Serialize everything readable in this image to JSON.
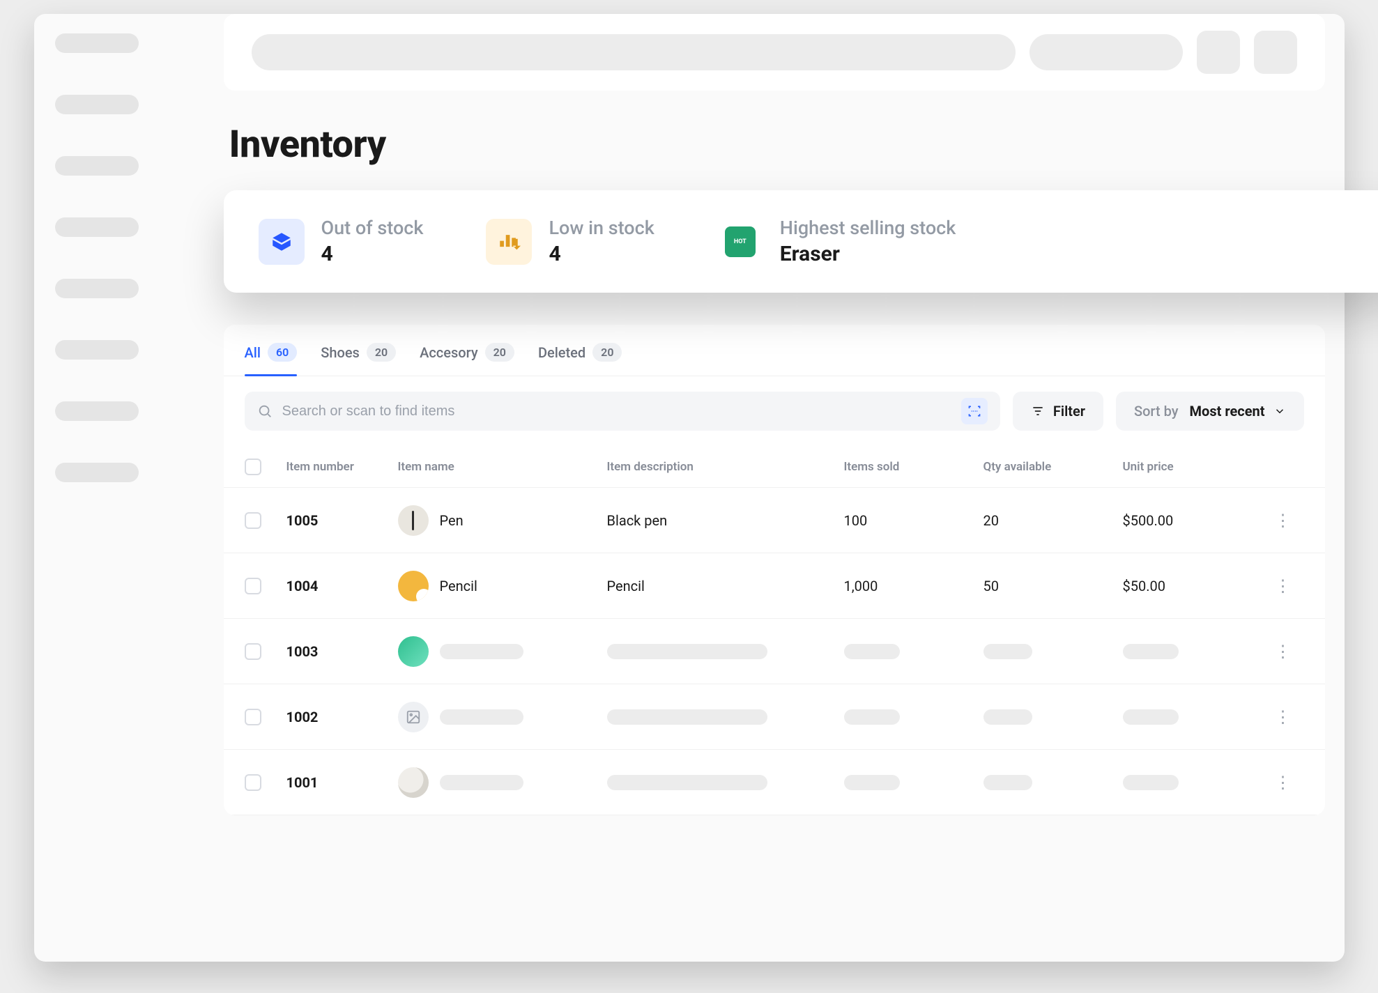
{
  "page": {
    "title": "Inventory"
  },
  "stats": {
    "out_of_stock": {
      "label": "Out of stock",
      "value": "4"
    },
    "low_in_stock": {
      "label": "Low in stock",
      "value": "4"
    },
    "highest_selling": {
      "label": "Highest selling stock",
      "value": "Eraser"
    }
  },
  "tabs": [
    {
      "label": "All",
      "count": "60",
      "active": true
    },
    {
      "label": "Shoes",
      "count": "20",
      "active": false
    },
    {
      "label": "Accesory",
      "count": "20",
      "active": false
    },
    {
      "label": "Deleted",
      "count": "20",
      "active": false
    }
  ],
  "search": {
    "placeholder": "Search or scan to find items"
  },
  "filter": {
    "label": "Filter"
  },
  "sort": {
    "label": "Sort by",
    "value": "Most recent"
  },
  "columns": {
    "item_number": "Item number",
    "item_name": "Item name",
    "item_description": "Item description",
    "items_sold": "Items sold",
    "qty_available": "Qty available",
    "unit_price": "Unit price"
  },
  "rows": [
    {
      "number": "1005",
      "name": "Pen",
      "desc": "Black pen",
      "sold": "100",
      "qty": "20",
      "price": "$500.00",
      "thumb": "pen"
    },
    {
      "number": "1004",
      "name": "Pencil",
      "desc": "Pencil",
      "sold": "1,000",
      "qty": "50",
      "price": "$50.00",
      "thumb": "pencil"
    },
    {
      "number": "1003",
      "name": "",
      "desc": "",
      "sold": "",
      "qty": "",
      "price": "",
      "thumb": "green",
      "placeholder": true
    },
    {
      "number": "1002",
      "name": "",
      "desc": "",
      "sold": "",
      "qty": "",
      "price": "",
      "thumb": "img",
      "placeholder": true
    },
    {
      "number": "1001",
      "name": "",
      "desc": "",
      "sold": "",
      "qty": "",
      "price": "",
      "thumb": "glasses",
      "placeholder": true
    }
  ]
}
